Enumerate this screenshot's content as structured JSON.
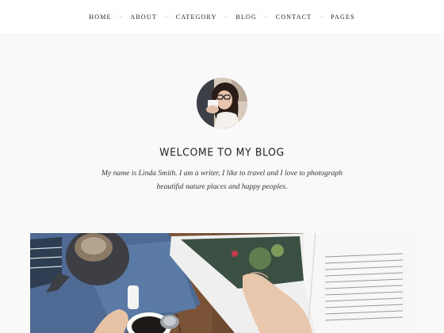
{
  "nav": {
    "items": [
      {
        "label": "HOME"
      },
      {
        "label": "ABOUT"
      },
      {
        "label": "CATEGORY"
      },
      {
        "label": "BLOG"
      },
      {
        "label": "CONTACT"
      },
      {
        "label": "PAGES"
      }
    ],
    "separator": "~"
  },
  "profile": {
    "title": "WELCOME TO MY BLOG",
    "intro": "My name is Linda Smith. I am a writer, I like to travel and I love to photograph beautiful nature places and happy peoples."
  },
  "colors": {
    "background": "#f9f9f9",
    "nav_background": "#ffffff",
    "text": "#222222"
  }
}
